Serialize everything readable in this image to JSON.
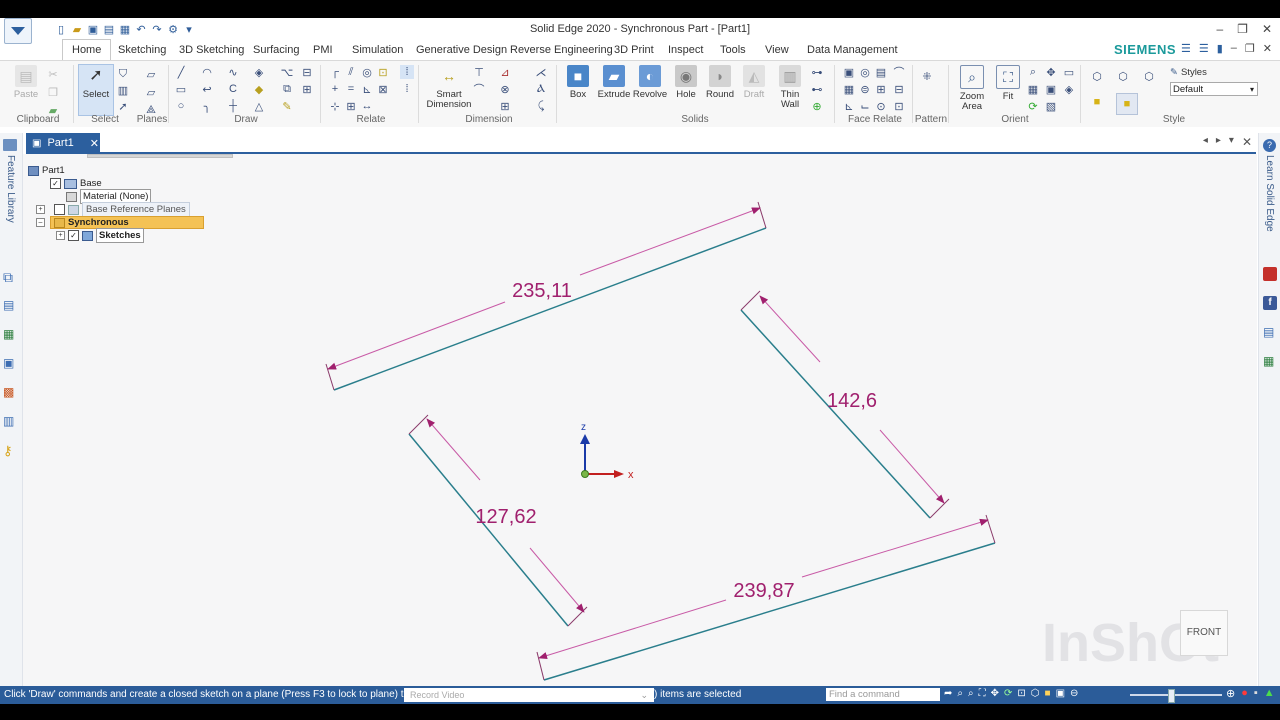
{
  "window": {
    "title": "Solid Edge 2020 - Synchronous Part - [Part1]"
  },
  "tabs": [
    "Home",
    "Sketching",
    "3D Sketching",
    "Surfacing",
    "PMI",
    "Simulation",
    "Generative Design",
    "Reverse Engineering",
    "3D Print",
    "Inspect",
    "Tools",
    "View",
    "Data Management"
  ],
  "brand": "SIEMENS",
  "ribbon": {
    "groups": [
      "Clipboard",
      "Select",
      "Planes",
      "Draw",
      "Relate",
      "Dimension",
      "Solids",
      "Face Relate",
      "Pattern",
      "Orient",
      "Style"
    ],
    "paste": "Paste",
    "select": "Select",
    "smart_dimension": "Smart\nDimension",
    "box": "Box",
    "extrude": "Extrude",
    "revolve": "Revolve",
    "hole": "Hole",
    "round": "Round",
    "draft": "Draft",
    "thin_wall": "Thin\nWall",
    "zoom_area": "Zoom\nArea",
    "fit": "Fit",
    "styles_label": "Styles",
    "styles_value": "Default"
  },
  "document": {
    "tab": "Part1"
  },
  "side": {
    "left": "Feature Library",
    "right": "Learn Solid Edge"
  },
  "tree": {
    "root": "Part1",
    "base": "Base",
    "material": "Material (None)",
    "ref_planes": "Base Reference Planes",
    "synchronous": "Synchronous",
    "sketches": "Sketches"
  },
  "dimensions": [
    "235,11",
    "142,6",
    "127,62",
    "239,87"
  ],
  "axes": {
    "z": "z",
    "x": "x"
  },
  "viewcube": "FRONT",
  "status": {
    "hint": "Click 'Draw' commands and create a closed sketch on a plane (Press F3 to lock to plane) the",
    "record": "Record Video",
    "selected": ") items are selected",
    "find_placeholder": "Find a command"
  },
  "watermark": "InShOt",
  "colors": {
    "dimension": "#a0206e",
    "sketch_line": "#2a7e8c",
    "accent": "#2c5f9e",
    "brand": "#1b9a9b"
  }
}
